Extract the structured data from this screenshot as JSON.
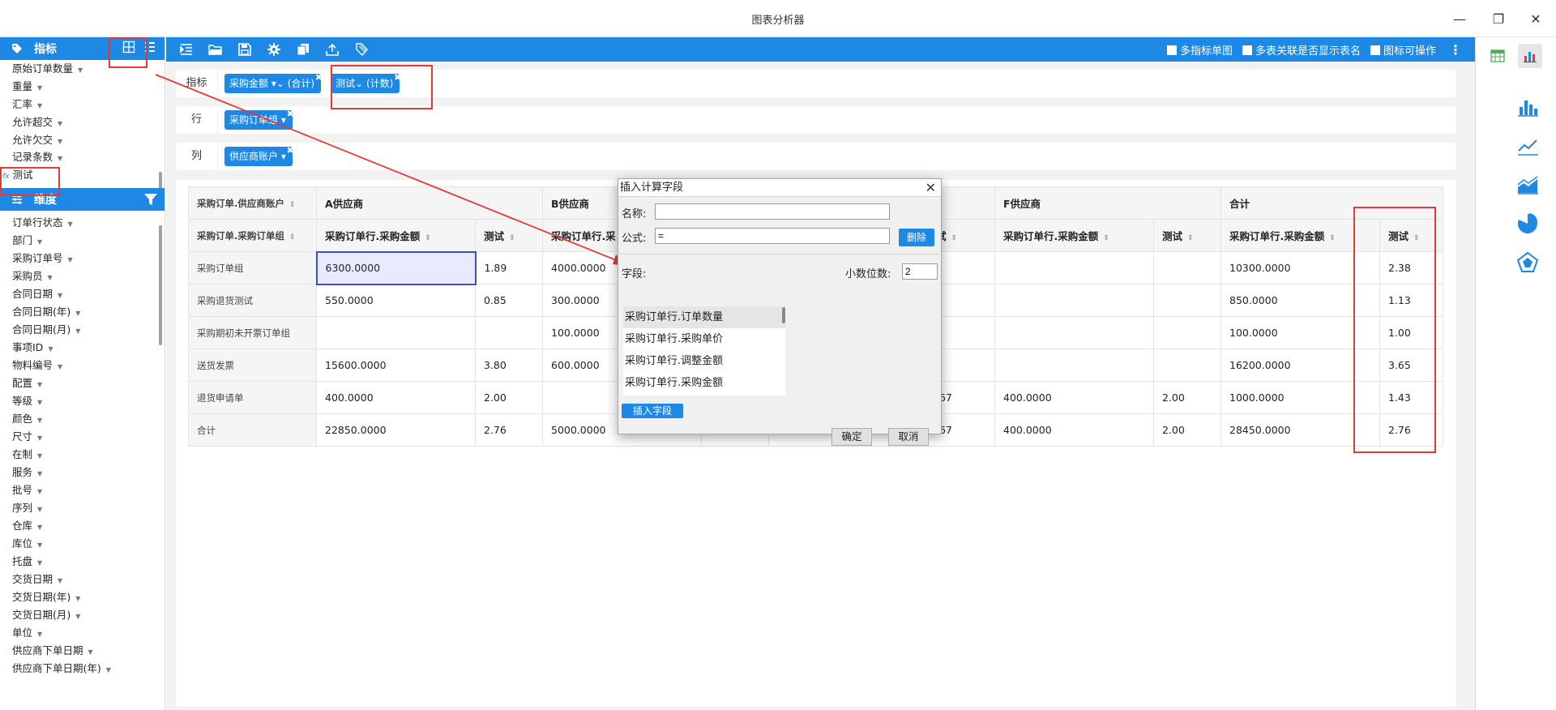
{
  "window": {
    "title": "图表分析器",
    "minimize": "—",
    "restore": "❐",
    "close": "✕"
  },
  "left": {
    "metrics_title": "指标",
    "metrics": [
      "原始订单数量",
      "重量",
      "汇率",
      "允许超交",
      "允许欠交",
      "记录条数"
    ],
    "calc_field_prefix": "fx",
    "calc_field": "测试",
    "dimensions_title": "维度",
    "dimensions": [
      "订单行状态",
      "部门",
      "采购订单号",
      "采购员",
      "合同日期",
      "合同日期(年)",
      "合同日期(月)",
      "事项ID",
      "物料编号",
      "配置",
      "等级",
      "颜色",
      "尺寸",
      "在制",
      "服务",
      "批号",
      "序列",
      "仓库",
      "库位",
      "托盘",
      "交货日期",
      "交货日期(年)",
      "交货日期(月)",
      "单位",
      "供应商下单日期",
      "供应商下单日期(年)"
    ]
  },
  "toolbar": {
    "multi_metric_single_chart": "多指标单图",
    "show_table_name": "多表关联是否显示表名",
    "chart_operable": "图标可操作"
  },
  "shelves": {
    "metric_label": "指标",
    "metric_chips": [
      {
        "text": "采购金额 ▾⌄ (合计)"
      },
      {
        "text": "测试⌄ (计数)"
      }
    ],
    "row_label": "行",
    "row_chip": "采购订单组 ▾",
    "col_label": "列",
    "col_chip": "供应商账户 ▾",
    "remove": "✖"
  },
  "table": {
    "corner_top": "采购订单.供应商账户",
    "corner_bottom": "采购订单.采购订单组",
    "groups": [
      "A供应商",
      "B供应商",
      "",
      "",
      "F供应商",
      "合计"
    ],
    "measure_amount": "采购订单行.采购金额",
    "measure_test": "测试",
    "partial_b_amount": "采购订单行.采",
    "partial_col": "试",
    "rows": [
      {
        "label": "采购订单组",
        "cells": [
          "6300.0000",
          "1.89",
          "4000.0000",
          "",
          "",
          "",
          "",
          "",
          "10300.0000",
          "2.38"
        ]
      },
      {
        "label": "采购退货测试",
        "cells": [
          "550.0000",
          "0.85",
          "300.0000",
          "",
          "",
          "",
          "",
          "",
          "850.0000",
          "1.13"
        ]
      },
      {
        "label": "采购期初未开票订单组",
        "cells": [
          "",
          "",
          "100.0000",
          "",
          "",
          "",
          "",
          "",
          "100.0000",
          "1.00"
        ]
      },
      {
        "label": "送货发票",
        "cells": [
          "15600.0000",
          "3.80",
          "600.0000",
          "",
          "",
          "",
          "",
          "",
          "16200.0000",
          "3.65"
        ]
      },
      {
        "label": "退货申请单",
        "cells": [
          "400.0000",
          "2.00",
          "",
          "",
          "",
          ".67",
          "400.0000",
          "2.00",
          "1000.0000",
          "1.43"
        ]
      },
      {
        "label": "合计",
        "cells": [
          "22850.0000",
          "2.76",
          "5000.0000",
          "",
          "",
          ".67",
          "400.0000",
          "2.00",
          "28450.0000",
          "2.76"
        ]
      }
    ]
  },
  "dialog": {
    "title": "插入计算字段",
    "name_label": "名称:",
    "name_value": "",
    "formula_label": "公式:",
    "formula_value": "=",
    "delete_btn": "删除",
    "fields_label": "字段:",
    "decimals_label": "小数位数:",
    "decimals_value": "2",
    "fields": [
      "采购订单行.订单数量",
      "采购订单行.采购单价",
      "采购订单行.调整金额",
      "采购订单行.采购金额"
    ],
    "insert_btn": "插入字段",
    "ok_btn": "确定",
    "cancel_btn": "取消"
  },
  "colors": {
    "accent": "#1e88e5",
    "annotation": "#e53935"
  }
}
